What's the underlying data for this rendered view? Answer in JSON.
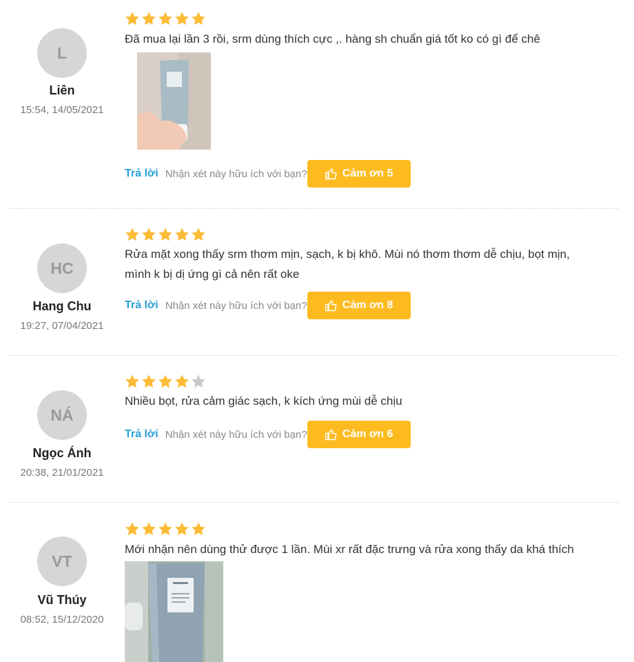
{
  "reviews": [
    {
      "initials": "L",
      "name": "Liên",
      "time": "15:54, 14/05/2021",
      "rating": 5,
      "text": "Đã mua lại lần 3 rồi, srm dùng thích cực ,. hàng sh chuẩn giá tốt ko có gì để chê",
      "reply_label": "Trả lời",
      "helpful_text": "Nhận xét này hữu ích với bạn?",
      "thanks_label": "Cảm ơn 5"
    },
    {
      "initials": "HC",
      "name": "Hang Chu",
      "time": "19:27, 07/04/2021",
      "rating": 5,
      "text_line1": "Rửa mặt xong thấy srm thơm mịn, sạch, k bị khô. Mùi nó thơm thơm dễ chịu, bọt mịn,",
      "text_line2": "mình k bị dị ứng gì cả nên rất oke",
      "reply_label": "Trả lời",
      "helpful_text": "Nhận xét này hữu ích với bạn?",
      "thanks_label": "Cảm ơn 8"
    },
    {
      "initials": "NÁ",
      "name": "Ngọc Ánh",
      "time": "20:38, 21/01/2021",
      "rating": 4,
      "text": "Nhiều bọt, rửa cảm giác sạch, k kích ứng mùi dễ chịu",
      "reply_label": "Trả lời",
      "helpful_text": "Nhận xét này hữu ích với bạn?",
      "thanks_label": "Cảm ơn 6"
    },
    {
      "initials": "VT",
      "name": "Vũ Thúy",
      "time": "08:52, 15/12/2020",
      "rating": 5,
      "text": " Mới nhận nên dùng thử được 1 lần. Mùi xr rất đặc trưng và rửa xong thấy da khá thích"
    }
  ],
  "colors": {
    "star_filled": "#fdbb35",
    "star_empty": "#c8c8c8",
    "thanks_button": "#fdbb1f",
    "reply_link": "#2a9fd6"
  },
  "icons": {
    "star": "star-icon",
    "thumbs_up": "thumbs-up-icon"
  }
}
